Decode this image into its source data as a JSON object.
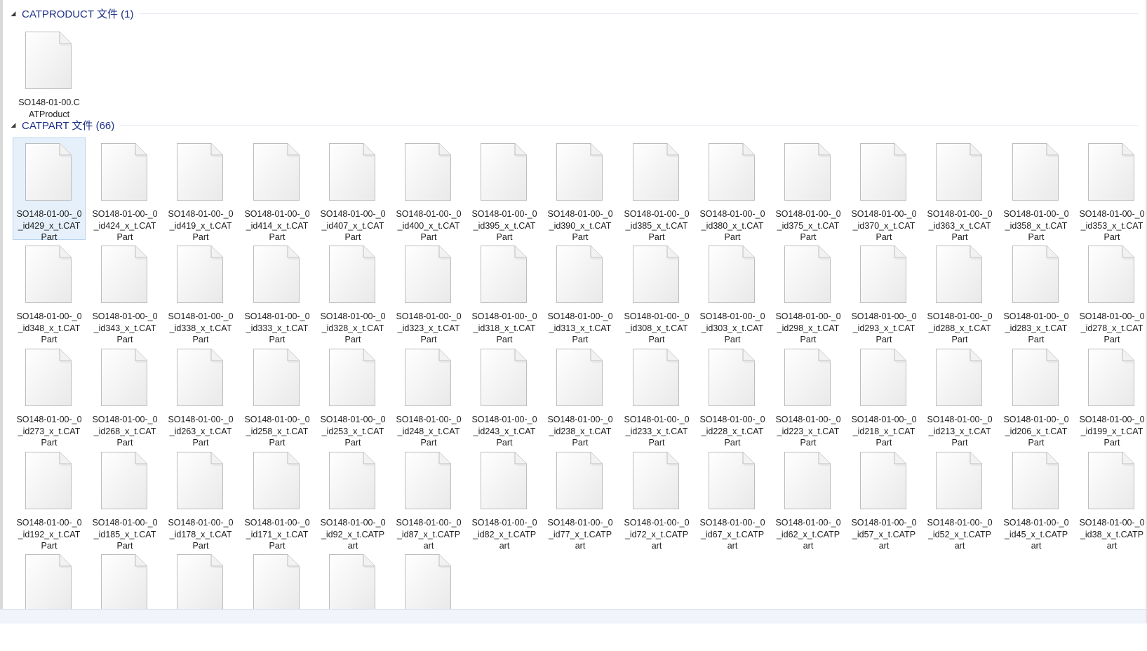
{
  "groups": [
    {
      "title": "CATPRODUCT 文件 (1)",
      "toggle_icon": "collapse-triangle-icon",
      "files": [
        {
          "lines": [
            "SO148-01-00.C",
            "ATProduct"
          ]
        }
      ]
    },
    {
      "title": "CATPART 文件 (66)",
      "toggle_icon": "collapse-triangle-icon",
      "files": [
        {
          "lines": [
            "SO148-01-00-_0",
            "_id429_x_t.CAT",
            "Part"
          ],
          "selected": true
        },
        {
          "lines": [
            "SO148-01-00-_0",
            "_id424_x_t.CAT",
            "Part"
          ]
        },
        {
          "lines": [
            "SO148-01-00-_0",
            "_id419_x_t.CAT",
            "Part"
          ]
        },
        {
          "lines": [
            "SO148-01-00-_0",
            "_id414_x_t.CAT",
            "Part"
          ]
        },
        {
          "lines": [
            "SO148-01-00-_0",
            "_id407_x_t.CAT",
            "Part"
          ]
        },
        {
          "lines": [
            "SO148-01-00-_0",
            "_id400_x_t.CAT",
            "Part"
          ]
        },
        {
          "lines": [
            "SO148-01-00-_0",
            "_id395_x_t.CAT",
            "Part"
          ]
        },
        {
          "lines": [
            "SO148-01-00-_0",
            "_id390_x_t.CAT",
            "Part"
          ]
        },
        {
          "lines": [
            "SO148-01-00-_0",
            "_id385_x_t.CAT",
            "Part"
          ]
        },
        {
          "lines": [
            "SO148-01-00-_0",
            "_id380_x_t.CAT",
            "Part"
          ]
        },
        {
          "lines": [
            "SO148-01-00-_0",
            "_id375_x_t.CAT",
            "Part"
          ]
        },
        {
          "lines": [
            "SO148-01-00-_0",
            "_id370_x_t.CAT",
            "Part"
          ]
        },
        {
          "lines": [
            "SO148-01-00-_0",
            "_id363_x_t.CAT",
            "Part"
          ]
        },
        {
          "lines": [
            "SO148-01-00-_0",
            "_id358_x_t.CAT",
            "Part"
          ]
        },
        {
          "lines": [
            "SO148-01-00-_0",
            "_id353_x_t.CAT",
            "Part"
          ]
        },
        {
          "lines": [
            "SO148-01-00-_0",
            "_id348_x_t.CAT",
            "Part"
          ]
        },
        {
          "lines": [
            "SO148-01-00-_0",
            "_id343_x_t.CAT",
            "Part"
          ]
        },
        {
          "lines": [
            "SO148-01-00-_0",
            "_id338_x_t.CAT",
            "Part"
          ]
        },
        {
          "lines": [
            "SO148-01-00-_0",
            "_id333_x_t.CAT",
            "Part"
          ]
        },
        {
          "lines": [
            "SO148-01-00-_0",
            "_id328_x_t.CAT",
            "Part"
          ]
        },
        {
          "lines": [
            "SO148-01-00-_0",
            "_id323_x_t.CAT",
            "Part"
          ]
        },
        {
          "lines": [
            "SO148-01-00-_0",
            "_id318_x_t.CAT",
            "Part"
          ]
        },
        {
          "lines": [
            "SO148-01-00-_0",
            "_id313_x_t.CAT",
            "Part"
          ]
        },
        {
          "lines": [
            "SO148-01-00-_0",
            "_id308_x_t.CAT",
            "Part"
          ]
        },
        {
          "lines": [
            "SO148-01-00-_0",
            "_id303_x_t.CAT",
            "Part"
          ]
        },
        {
          "lines": [
            "SO148-01-00-_0",
            "_id298_x_t.CAT",
            "Part"
          ]
        },
        {
          "lines": [
            "SO148-01-00-_0",
            "_id293_x_t.CAT",
            "Part"
          ]
        },
        {
          "lines": [
            "SO148-01-00-_0",
            "_id288_x_t.CAT",
            "Part"
          ]
        },
        {
          "lines": [
            "SO148-01-00-_0",
            "_id283_x_t.CAT",
            "Part"
          ]
        },
        {
          "lines": [
            "SO148-01-00-_0",
            "_id278_x_t.CAT",
            "Part"
          ]
        },
        {
          "lines": [
            "SO148-01-00-_0",
            "_id273_x_t.CAT",
            "Part"
          ]
        },
        {
          "lines": [
            "SO148-01-00-_0",
            "_id268_x_t.CAT",
            "Part"
          ]
        },
        {
          "lines": [
            "SO148-01-00-_0",
            "_id263_x_t.CAT",
            "Part"
          ]
        },
        {
          "lines": [
            "SO148-01-00-_0",
            "_id258_x_t.CAT",
            "Part"
          ]
        },
        {
          "lines": [
            "SO148-01-00-_0",
            "_id253_x_t.CAT",
            "Part"
          ]
        },
        {
          "lines": [
            "SO148-01-00-_0",
            "_id248_x_t.CAT",
            "Part"
          ]
        },
        {
          "lines": [
            "SO148-01-00-_0",
            "_id243_x_t.CAT",
            "Part"
          ]
        },
        {
          "lines": [
            "SO148-01-00-_0",
            "_id238_x_t.CAT",
            "Part"
          ]
        },
        {
          "lines": [
            "SO148-01-00-_0",
            "_id233_x_t.CAT",
            "Part"
          ]
        },
        {
          "lines": [
            "SO148-01-00-_0",
            "_id228_x_t.CAT",
            "Part"
          ]
        },
        {
          "lines": [
            "SO148-01-00-_0",
            "_id223_x_t.CAT",
            "Part"
          ]
        },
        {
          "lines": [
            "SO148-01-00-_0",
            "_id218_x_t.CAT",
            "Part"
          ]
        },
        {
          "lines": [
            "SO148-01-00-_0",
            "_id213_x_t.CAT",
            "Part"
          ]
        },
        {
          "lines": [
            "SO148-01-00-_0",
            "_id206_x_t.CAT",
            "Part"
          ]
        },
        {
          "lines": [
            "SO148-01-00-_0",
            "_id199_x_t.CAT",
            "Part"
          ]
        },
        {
          "lines": [
            "SO148-01-00-_0",
            "_id192_x_t.CAT",
            "Part"
          ]
        },
        {
          "lines": [
            "SO148-01-00-_0",
            "_id185_x_t.CAT",
            "Part"
          ]
        },
        {
          "lines": [
            "SO148-01-00-_0",
            "_id178_x_t.CAT",
            "Part"
          ]
        },
        {
          "lines": [
            "SO148-01-00-_0",
            "_id171_x_t.CAT",
            "Part"
          ]
        },
        {
          "lines": [
            "SO148-01-00-_0",
            "_id92_x_t.CATP",
            "art"
          ]
        },
        {
          "lines": [
            "SO148-01-00-_0",
            "_id87_x_t.CATP",
            "art"
          ]
        },
        {
          "lines": [
            "SO148-01-00-_0",
            "_id82_x_t.CATP",
            "art"
          ]
        },
        {
          "lines": [
            "SO148-01-00-_0",
            "_id77_x_t.CATP",
            "art"
          ]
        },
        {
          "lines": [
            "SO148-01-00-_0",
            "_id72_x_t.CATP",
            "art"
          ]
        },
        {
          "lines": [
            "SO148-01-00-_0",
            "_id67_x_t.CATP",
            "art"
          ]
        },
        {
          "lines": [
            "SO148-01-00-_0",
            "_id62_x_t.CATP",
            "art"
          ]
        },
        {
          "lines": [
            "SO148-01-00-_0",
            "_id57_x_t.CATP",
            "art"
          ]
        },
        {
          "lines": [
            "SO148-01-00-_0",
            "_id52_x_t.CATP",
            "art"
          ]
        },
        {
          "lines": [
            "SO148-01-00-_0",
            "_id45_x_t.CATP",
            "art"
          ]
        },
        {
          "lines": [
            "SO148-01-00-_0",
            "_id38_x_t.CATP",
            "art"
          ]
        },
        {
          "lines": []
        },
        {
          "lines": []
        },
        {
          "lines": []
        },
        {
          "lines": []
        },
        {
          "lines": []
        },
        {
          "lines": []
        }
      ]
    }
  ]
}
